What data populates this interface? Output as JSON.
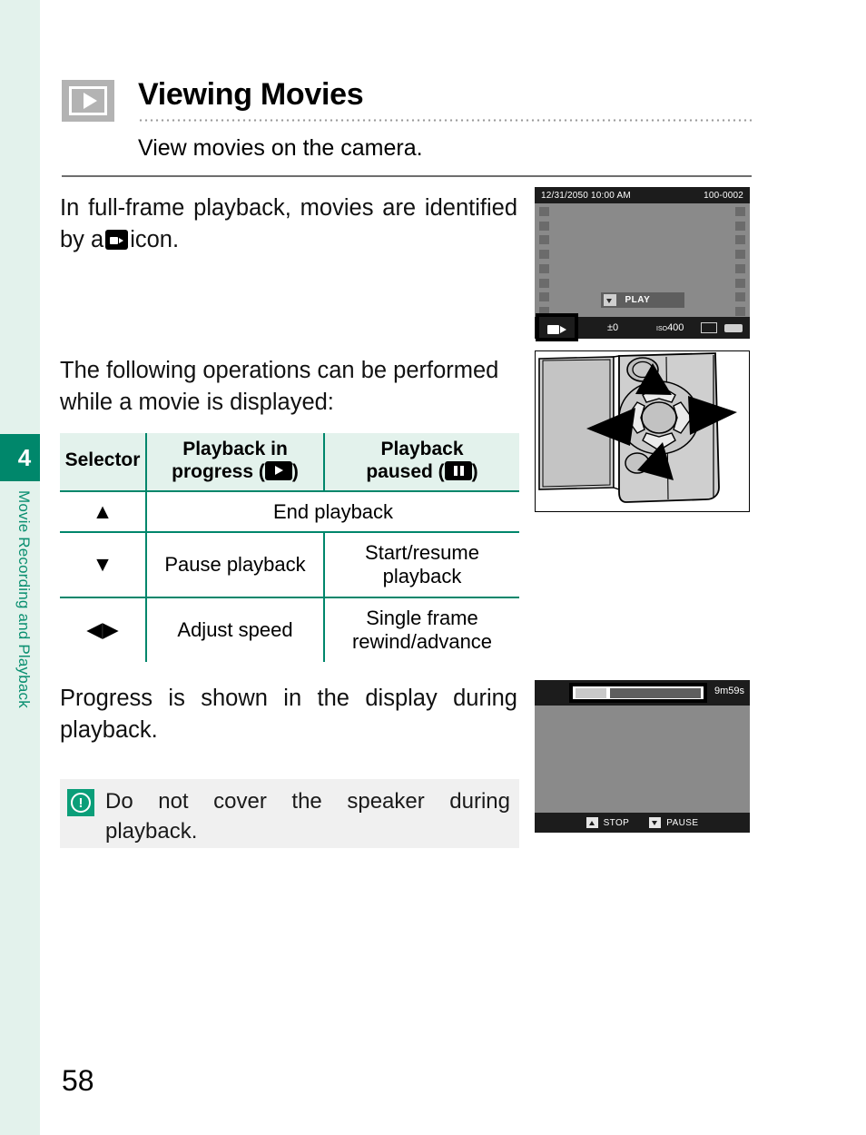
{
  "sidebar": {
    "chapter_number": "4",
    "chapter_title": "Movie Recording and Playback"
  },
  "header": {
    "icon": "playback-play-icon",
    "title": "Viewing Movies",
    "subtitle": "View movies on the camera."
  },
  "body": {
    "paragraph_1_before": "In full-frame playback, movies are identified by a",
    "paragraph_1_after": "icon.",
    "paragraph_2": "The following operations can be performed while a movie is displayed:",
    "paragraph_3": "Progress is shown in the display during playback."
  },
  "table": {
    "headers": {
      "selector": "Selector",
      "in_progress_line1": "Playback in",
      "in_progress_line2": "progress (",
      "in_progress_close": ")",
      "paused_line1": "Playback",
      "paused_line2": "paused (",
      "paused_close": ")"
    },
    "rows": [
      {
        "selector": "▲",
        "selector_name": "up",
        "span_text": "End playback",
        "spans_both": true
      },
      {
        "selector": "▼",
        "selector_name": "down",
        "in_progress": "Pause playback",
        "paused": "Start/resume playback",
        "spans_both": false
      },
      {
        "selector": "◀▶",
        "selector_name": "left-right",
        "in_progress": "Adjust speed",
        "paused": "Single frame rewind/advance",
        "spans_both": false
      }
    ]
  },
  "note": {
    "icon": "warning-exclamation-icon",
    "text": "Do not cover the speaker during playback."
  },
  "figures": {
    "lcd_fullframe": {
      "datetime": "12/31/2050 10:00 AM",
      "frame_number": "100-0002",
      "play_label": "PLAY",
      "exposure_comp": "±0",
      "iso_prefix": "ISO",
      "iso_value": "400",
      "movie_badge": "movie-icon"
    },
    "camera_selector": {
      "caption": "camera-rear-selector-illustration"
    },
    "lcd_progress": {
      "time_remaining": "9m59s",
      "progress_percent": 26,
      "stop_label": "STOP",
      "pause_label": "PAUSE"
    }
  },
  "page_number": "58",
  "colors": {
    "brand_green": "#00876b",
    "sidebar_tint": "#e3f2ec",
    "table_border": "#00866b",
    "note_bg": "#f0f0f0",
    "note_icon": "#0b9e79"
  }
}
